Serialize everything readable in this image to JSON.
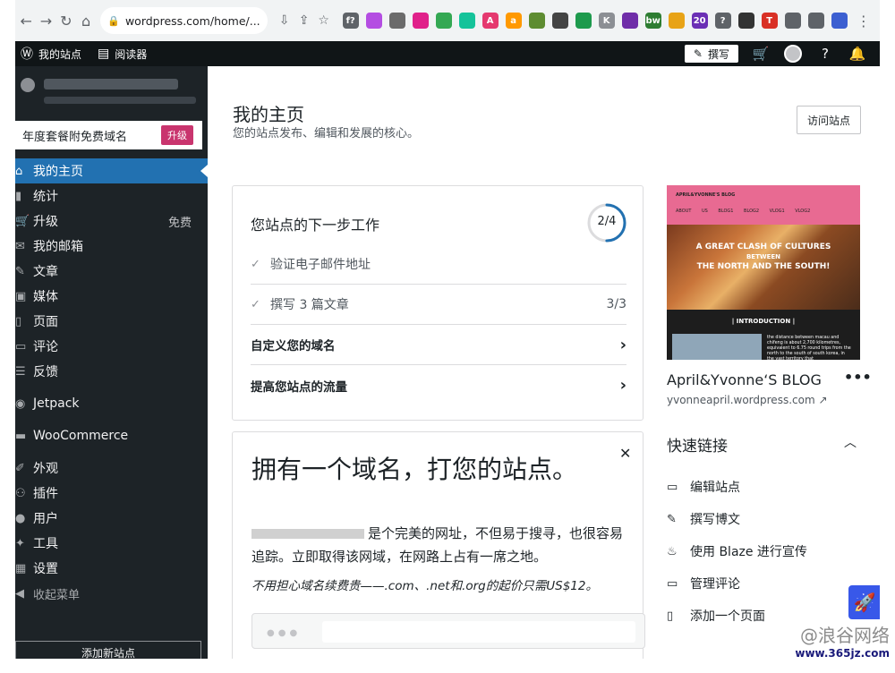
{
  "browser": {
    "url": "wordpress.com/home/...",
    "nav": [
      "back-icon",
      "forward-icon",
      "reload-icon",
      "home-icon"
    ],
    "extensions": [
      {
        "name": "fx-extension",
        "label": "f?",
        "color": "#5f6368"
      },
      {
        "name": "feather-extension",
        "label": "",
        "color": "#b44de2"
      },
      {
        "name": "camera-extension",
        "label": "",
        "color": "#6b6b6b"
      },
      {
        "name": "pink-extension",
        "label": "",
        "color": "#e0218a"
      },
      {
        "name": "green-doc-extension",
        "label": "",
        "color": "#34a853"
      },
      {
        "name": "grammarly-extension",
        "label": "",
        "color": "#15c39a"
      },
      {
        "name": "a-extension",
        "label": "A",
        "color": "#e5396f"
      },
      {
        "name": "amazon-extension",
        "label": "a",
        "color": "#ff9900"
      },
      {
        "name": "glasses-extension",
        "label": "",
        "color": "#5e8c31"
      },
      {
        "name": "calculator-extension",
        "label": "",
        "color": "#444"
      },
      {
        "name": "green-circle-extension",
        "label": "",
        "color": "#1e9a4d"
      },
      {
        "name": "k-extension",
        "label": "K",
        "color": "#8c8f94"
      },
      {
        "name": "chart-extension",
        "label": "",
        "color": "#6f2da8"
      },
      {
        "name": "bw-extension",
        "label": "bw",
        "color": "#2e7d32"
      },
      {
        "name": "sun-extension",
        "label": "",
        "color": "#e8a317"
      },
      {
        "name": "badge-extension",
        "label": "20",
        "color": "#6b2fb5"
      },
      {
        "name": "help-extension",
        "label": "?",
        "color": "#5f6368"
      },
      {
        "name": "bank-extension",
        "label": "",
        "color": "#333"
      },
      {
        "name": "t-extension",
        "label": "T",
        "color": "#d93025"
      },
      {
        "name": "puzzle-extension",
        "label": "",
        "color": "#5f6368"
      },
      {
        "name": "panel-extension",
        "label": "",
        "color": "#5f6368"
      },
      {
        "name": "profile-extension",
        "label": "",
        "color": "#3c5fd1"
      }
    ]
  },
  "adminbar": {
    "my_site": "我的站点",
    "reader": "阅读器",
    "write": "撰写"
  },
  "sidebar": {
    "upsell_text": "年度套餐附免费域名",
    "upsell_button": "升级",
    "items": [
      {
        "id": "home",
        "label": "我的主页",
        "icon": "home-icon",
        "active": true
      },
      {
        "id": "stats",
        "label": "统计",
        "icon": "stats-icon"
      },
      {
        "id": "upgrades",
        "label": "升级",
        "icon": "cart-icon",
        "extra": "免费"
      },
      {
        "id": "inbox",
        "label": "我的邮箱",
        "icon": "mail-icon"
      },
      {
        "id": "posts",
        "label": "文章",
        "icon": "pin-icon"
      },
      {
        "id": "media",
        "label": "媒体",
        "icon": "media-icon"
      },
      {
        "id": "pages",
        "label": "页面",
        "icon": "page-icon"
      },
      {
        "id": "comments",
        "label": "评论",
        "icon": "comment-icon"
      },
      {
        "id": "feedback",
        "label": "反馈",
        "icon": "feedback-icon"
      },
      {
        "id": "jetpack",
        "label": "Jetpack",
        "icon": "jetpack-icon",
        "sep": true
      },
      {
        "id": "woocommerce",
        "label": "WooCommerce",
        "icon": "woo-icon",
        "sep": true
      },
      {
        "id": "appearance",
        "label": "外观",
        "icon": "brush-icon",
        "sep": true
      },
      {
        "id": "plugins",
        "label": "插件",
        "icon": "plugin-icon"
      },
      {
        "id": "users",
        "label": "用户",
        "icon": "user-icon"
      },
      {
        "id": "tools",
        "label": "工具",
        "icon": "wrench-icon"
      },
      {
        "id": "settings",
        "label": "设置",
        "icon": "settings-icon"
      },
      {
        "id": "collapse",
        "label": "收起菜单",
        "icon": "collapse-icon"
      }
    ],
    "add_site": "添加新站点"
  },
  "main": {
    "title": "我的主页",
    "subtitle": "您的站点发布、编辑和发展的核心。",
    "visit_button": "访问站点",
    "tasks": {
      "title": "您站点的下一步工作",
      "progress_label": "2/4",
      "progress": 0.5,
      "items": [
        {
          "label": "验证电子邮件地址",
          "done": true,
          "right": ""
        },
        {
          "label": "撰写 3 篇文章",
          "done": true,
          "right": "3/3"
        },
        {
          "label": "自定义您的域名",
          "done": false,
          "right": "›"
        },
        {
          "label": "提高您站点的流量",
          "done": false,
          "right": "›"
        }
      ]
    },
    "domain": {
      "title": "拥有一个域名，打您的站点。",
      "body_1": "是个完美的网址，不但易于搜寻，也很容易追踪。立即取得该网域，在网路上占有一席之地。",
      "note": "不用担心域名续费贵——.com、.net和.org的起价只需US$12。"
    }
  },
  "right": {
    "preview": {
      "blog_header": "APRIL&YVONNE'S BLOG",
      "nav": "ABOUT US BLOG1 BLOG2 VLOG1 VLOG2",
      "headline_1": "A GREAT CLASH OF CULTURES",
      "headline_2": "BETWEEN",
      "headline_3": "THE NORTH AND THE SOUTH!",
      "intro": "| INTRODUCTION |",
      "text": "the distance between macau and chifeng is about 2,700 kilometres, equivalent to 6.75 round trips from the north to the south of south korea, in the vast territory that"
    },
    "blog_name": "April&Yvonne‘S BLOG",
    "blog_url": "yvonneapril.wordpress.com",
    "quick_links_title": "快速链接",
    "quick_links": [
      {
        "label": "编辑站点",
        "icon": "laptop-icon"
      },
      {
        "label": "撰写博文",
        "icon": "pencil-icon"
      },
      {
        "label": "使用 Blaze 进行宣传",
        "icon": "flame-icon"
      },
      {
        "label": "管理评论",
        "icon": "comment-icon"
      },
      {
        "label": "添加一个页面",
        "icon": "page-icon"
      }
    ]
  },
  "watermark": {
    "line1": "@浪谷网络",
    "line2": "www.365jz.com"
  }
}
